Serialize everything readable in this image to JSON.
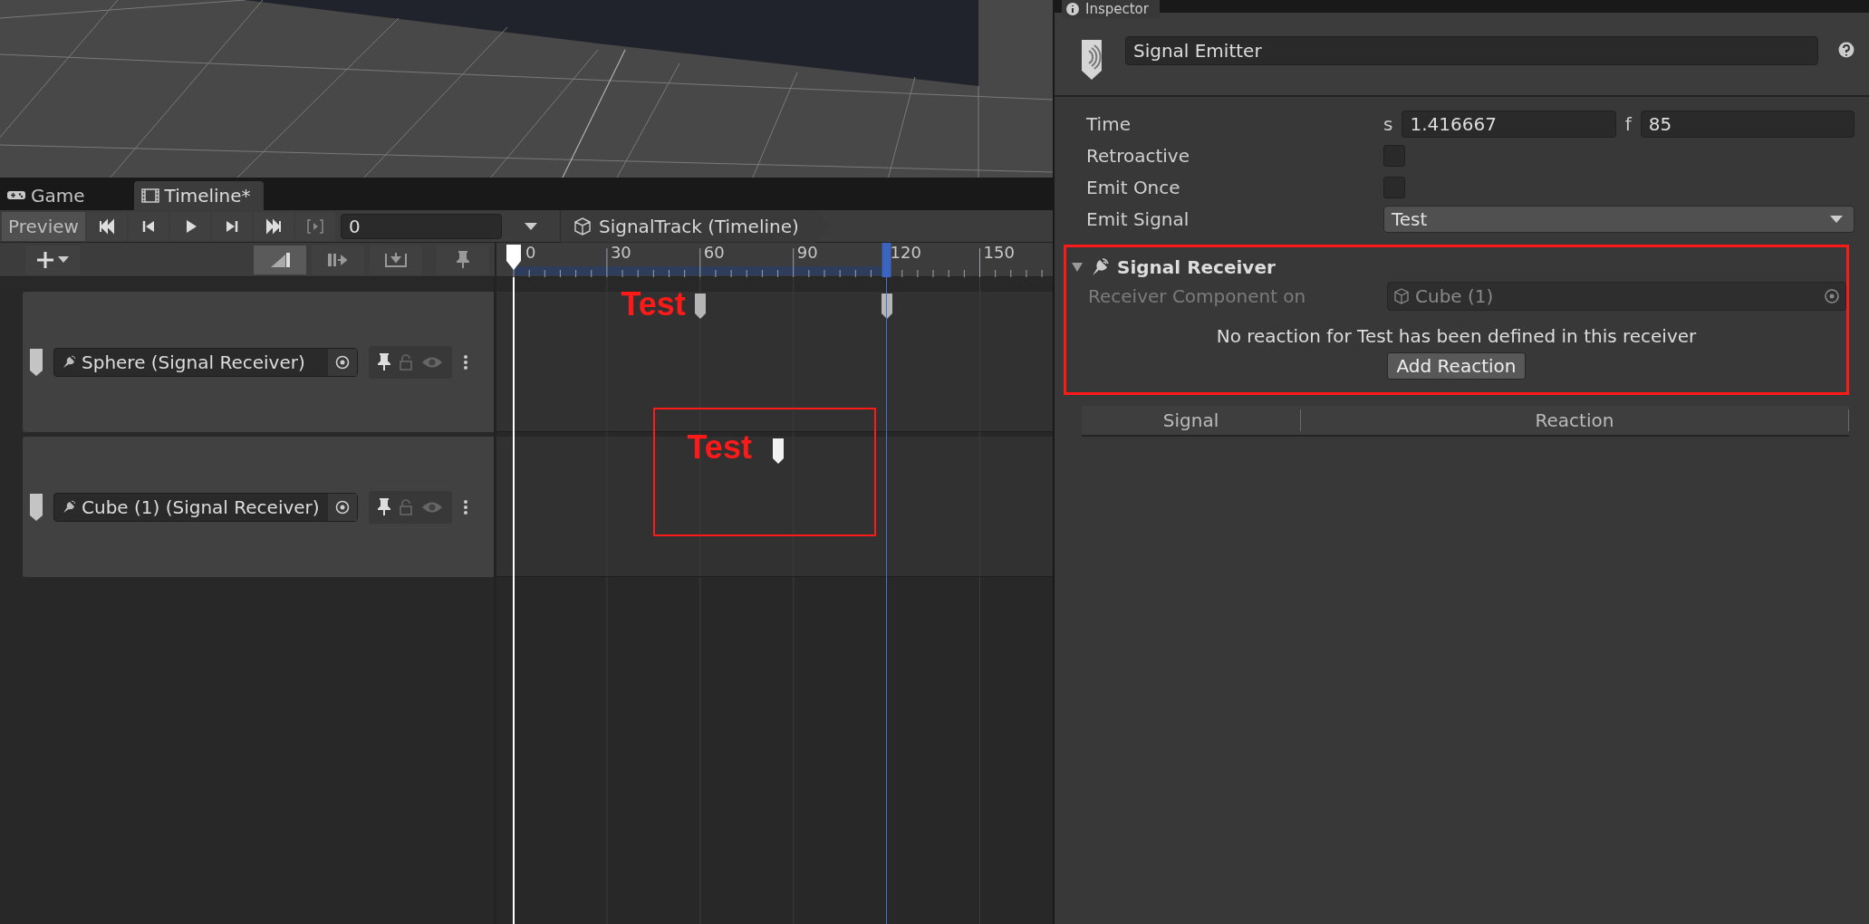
{
  "tabs": [
    {
      "label": "Game",
      "selected": false
    },
    {
      "label": "Timeline*",
      "selected": true
    }
  ],
  "toolbar": {
    "preview": "Preview",
    "transport": [
      {
        "kind": "skip_back"
      },
      {
        "kind": "step_back"
      },
      {
        "kind": "play"
      },
      {
        "kind": "step_forward"
      },
      {
        "kind": "skip_forward"
      },
      {
        "kind": "frame_play"
      }
    ],
    "frame": "0",
    "breadcrumb": "SignalTrack (Timeline)"
  },
  "edit_modes": [
    {
      "kind": "mix",
      "selected": true
    },
    {
      "kind": "ripple",
      "selected": false
    },
    {
      "kind": "replace",
      "selected": false
    }
  ],
  "timeline": {
    "ticks": [
      "0",
      "30",
      "60",
      "90",
      "120",
      "150"
    ]
  },
  "tracks": [
    {
      "name": "Sphere (Signal Receiver)",
      "markers": [
        {
          "selected": false,
          "callout": "Test",
          "boxed": false
        },
        {
          "selected": false
        }
      ]
    },
    {
      "name": "Cube (1) (Signal Receiver)",
      "markers": [
        {
          "selected": true,
          "callout": "Test",
          "boxed": true
        }
      ]
    }
  ],
  "inspector": {
    "tab": "Inspector",
    "object_name": "Signal Emitter",
    "fields": [
      {
        "kind": "time",
        "label": "Time",
        "s_label": "s",
        "s_value": "1.416667",
        "f_label": "f",
        "f_value": "85"
      },
      {
        "kind": "checkbox",
        "label": "Retroactive",
        "checked": false
      },
      {
        "kind": "checkbox",
        "label": "Emit Once",
        "checked": false
      },
      {
        "kind": "dropdown",
        "label": "Emit Signal",
        "value": "Test"
      }
    ],
    "receiver": {
      "title": "Signal Receiver",
      "expanded": true,
      "highlighted": true,
      "component_label": "Receiver Component on",
      "component_value": "Cube (1)",
      "message": "No reaction for Test has been defined in this receiver",
      "button": "Add Reaction"
    },
    "table": {
      "columns": [
        "Signal",
        "Reaction"
      ]
    }
  }
}
